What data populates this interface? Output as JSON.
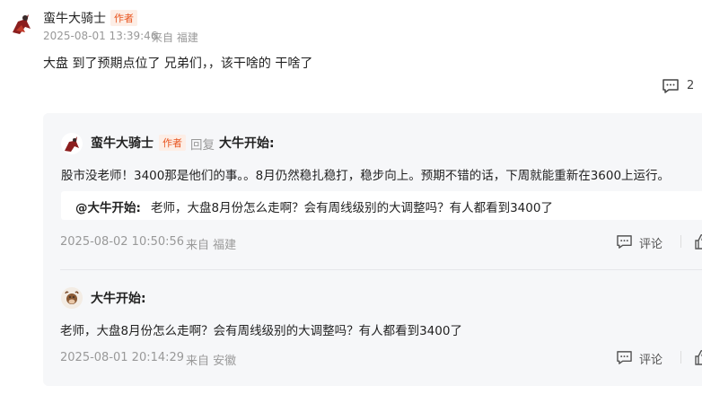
{
  "main_comment": {
    "author": "蛮牛大骑士",
    "badge": "作者",
    "time": "2025-08-01 13:39:46",
    "location": "来自 福建",
    "content": "大盘 到了预期点位了 兄弟们，，该干啥的 干啥了",
    "comment_count": "2"
  },
  "replies": [
    {
      "author": "蛮牛大骑士",
      "badge": "作者",
      "reply_word": "回复",
      "reply_to": "大牛开始:",
      "content": "股市没老师！3400那是他们的事。。8月仍然稳扎稳打，稳步向上。预期不错的话，下周就能重新在3600上运行。",
      "quote_author": "@大牛开始:",
      "quote_text": "老师，大盘8月份怎么走啊？会有周线级别的大调整吗？有人都看到3400了",
      "time": "2025-08-02 10:50:56",
      "location": "来自 福建",
      "comment_label": "评论"
    },
    {
      "author": "大牛开始:",
      "content": "老师，大盘8月份怎么走啊？会有周线级别的大调整吗？有人都看到3400了",
      "time": "2025-08-01 20:14:29",
      "location": "来自 安徽",
      "comment_label": "评论"
    }
  ],
  "colors": {
    "badge_text": "#e8541e",
    "badge_bg": "#fdeee6",
    "reply_bg": "#f6f7f9",
    "meta": "#999999"
  }
}
